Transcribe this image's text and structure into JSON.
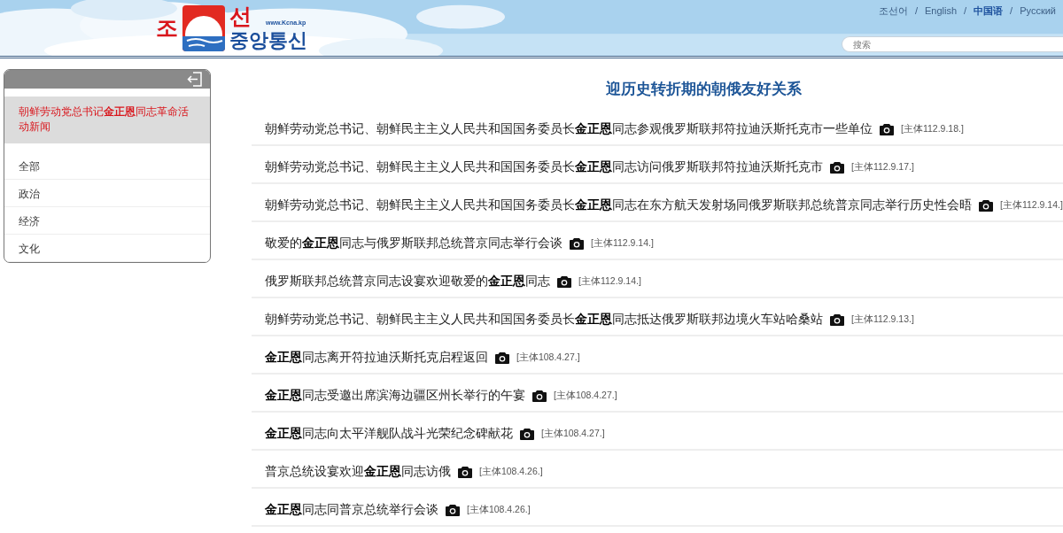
{
  "header": {
    "logo": {
      "left": "조",
      "right": "선",
      "bottom": "중앙통신",
      "url": "www.Kcna.kp"
    },
    "language_separator": "/",
    "languages": [
      {
        "label": "조선어",
        "selected": false
      },
      {
        "label": "English",
        "selected": false
      },
      {
        "label": "中国语",
        "selected": true
      },
      {
        "label": "Русский",
        "selected": false
      }
    ],
    "search": {
      "placeholder": "搜索"
    }
  },
  "sidebar": {
    "items": [
      {
        "label": "朝鲜劳动党总书记**金正恩**同志革命活动新闻",
        "selected": true
      },
      {
        "label": "全部",
        "selected": false
      },
      {
        "label": "政治",
        "selected": false
      },
      {
        "label": "经济",
        "selected": false
      },
      {
        "label": "文化",
        "selected": false
      }
    ]
  },
  "main": {
    "title": "迎历史转折期的朝俄友好关系",
    "articles": [
      {
        "title": "朝鲜劳动党总书记、朝鲜民主主义人民共和国国务委员长**金正恩**同志参观俄罗斯联邦符拉迪沃斯托克市一些单位",
        "date": "[主体112.9.18.]"
      },
      {
        "title": "朝鲜劳动党总书记、朝鲜民主主义人民共和国国务委员长**金正恩**同志访问俄罗斯联邦符拉迪沃斯托克市",
        "date": "[主体112.9.17.]"
      },
      {
        "title": "朝鲜劳动党总书记、朝鲜民主主义人民共和国国务委员长**金正恩**同志在东方航天发射场同俄罗斯联邦总统普京同志举行历史性会晤",
        "date": "[主体112.9.14.]"
      },
      {
        "title": "敬爱的**金正恩**同志与俄罗斯联邦总统普京同志举行会谈",
        "date": "[主体112.9.14.]"
      },
      {
        "title": "俄罗斯联邦总统普京同志设宴欢迎敬爱的**金正恩**同志",
        "date": "[主体112.9.14.]"
      },
      {
        "title": "朝鲜劳动党总书记、朝鲜民主主义人民共和国国务委员长**金正恩**同志抵达俄罗斯联邦边境火车站哈桑站",
        "date": "[主体112.9.13.]"
      },
      {
        "title": "**金正恩**同志离开符拉迪沃斯托克启程返回",
        "date": "[主体108.4.27.]"
      },
      {
        "title": "**金正恩**同志受邀出席滨海边疆区州长举行的午宴",
        "date": "[主体108.4.27.]"
      },
      {
        "title": "**金正恩**同志向太平洋舰队战斗光荣纪念碑献花",
        "date": "[主体108.4.27.]"
      },
      {
        "title": "普京总统设宴欢迎**金正恩**同志访俄",
        "date": "[主体108.4.26.]"
      },
      {
        "title": "**金正恩**同志同普京总统举行会谈",
        "date": "[主体108.4.26.]"
      }
    ]
  }
}
